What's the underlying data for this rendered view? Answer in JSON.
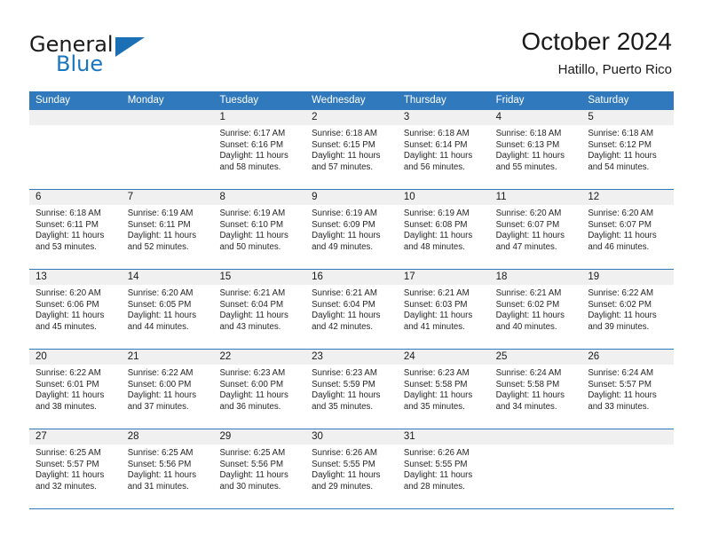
{
  "brand": {
    "name_part1": "General",
    "name_part2": "Blue",
    "flag_icon": "triangle-flag-icon"
  },
  "header": {
    "title": "October 2024",
    "location": "Hatillo, Puerto Rico"
  },
  "calendar": {
    "weekdays": [
      "Sunday",
      "Monday",
      "Tuesday",
      "Wednesday",
      "Thursday",
      "Friday",
      "Saturday"
    ],
    "accent_color": "#3079bd",
    "datestrip_color": "#f0f0f0",
    "weeks": [
      [
        {
          "day": "",
          "sunrise": "",
          "sunset": "",
          "daylight_l1": "",
          "daylight_l2": ""
        },
        {
          "day": "",
          "sunrise": "",
          "sunset": "",
          "daylight_l1": "",
          "daylight_l2": ""
        },
        {
          "day": "1",
          "sunrise": "Sunrise: 6:17 AM",
          "sunset": "Sunset: 6:16 PM",
          "daylight_l1": "Daylight: 11 hours",
          "daylight_l2": "and 58 minutes."
        },
        {
          "day": "2",
          "sunrise": "Sunrise: 6:18 AM",
          "sunset": "Sunset: 6:15 PM",
          "daylight_l1": "Daylight: 11 hours",
          "daylight_l2": "and 57 minutes."
        },
        {
          "day": "3",
          "sunrise": "Sunrise: 6:18 AM",
          "sunset": "Sunset: 6:14 PM",
          "daylight_l1": "Daylight: 11 hours",
          "daylight_l2": "and 56 minutes."
        },
        {
          "day": "4",
          "sunrise": "Sunrise: 6:18 AM",
          "sunset": "Sunset: 6:13 PM",
          "daylight_l1": "Daylight: 11 hours",
          "daylight_l2": "and 55 minutes."
        },
        {
          "day": "5",
          "sunrise": "Sunrise: 6:18 AM",
          "sunset": "Sunset: 6:12 PM",
          "daylight_l1": "Daylight: 11 hours",
          "daylight_l2": "and 54 minutes."
        }
      ],
      [
        {
          "day": "6",
          "sunrise": "Sunrise: 6:18 AM",
          "sunset": "Sunset: 6:11 PM",
          "daylight_l1": "Daylight: 11 hours",
          "daylight_l2": "and 53 minutes."
        },
        {
          "day": "7",
          "sunrise": "Sunrise: 6:19 AM",
          "sunset": "Sunset: 6:11 PM",
          "daylight_l1": "Daylight: 11 hours",
          "daylight_l2": "and 52 minutes."
        },
        {
          "day": "8",
          "sunrise": "Sunrise: 6:19 AM",
          "sunset": "Sunset: 6:10 PM",
          "daylight_l1": "Daylight: 11 hours",
          "daylight_l2": "and 50 minutes."
        },
        {
          "day": "9",
          "sunrise": "Sunrise: 6:19 AM",
          "sunset": "Sunset: 6:09 PM",
          "daylight_l1": "Daylight: 11 hours",
          "daylight_l2": "and 49 minutes."
        },
        {
          "day": "10",
          "sunrise": "Sunrise: 6:19 AM",
          "sunset": "Sunset: 6:08 PM",
          "daylight_l1": "Daylight: 11 hours",
          "daylight_l2": "and 48 minutes."
        },
        {
          "day": "11",
          "sunrise": "Sunrise: 6:20 AM",
          "sunset": "Sunset: 6:07 PM",
          "daylight_l1": "Daylight: 11 hours",
          "daylight_l2": "and 47 minutes."
        },
        {
          "day": "12",
          "sunrise": "Sunrise: 6:20 AM",
          "sunset": "Sunset: 6:07 PM",
          "daylight_l1": "Daylight: 11 hours",
          "daylight_l2": "and 46 minutes."
        }
      ],
      [
        {
          "day": "13",
          "sunrise": "Sunrise: 6:20 AM",
          "sunset": "Sunset: 6:06 PM",
          "daylight_l1": "Daylight: 11 hours",
          "daylight_l2": "and 45 minutes."
        },
        {
          "day": "14",
          "sunrise": "Sunrise: 6:20 AM",
          "sunset": "Sunset: 6:05 PM",
          "daylight_l1": "Daylight: 11 hours",
          "daylight_l2": "and 44 minutes."
        },
        {
          "day": "15",
          "sunrise": "Sunrise: 6:21 AM",
          "sunset": "Sunset: 6:04 PM",
          "daylight_l1": "Daylight: 11 hours",
          "daylight_l2": "and 43 minutes."
        },
        {
          "day": "16",
          "sunrise": "Sunrise: 6:21 AM",
          "sunset": "Sunset: 6:04 PM",
          "daylight_l1": "Daylight: 11 hours",
          "daylight_l2": "and 42 minutes."
        },
        {
          "day": "17",
          "sunrise": "Sunrise: 6:21 AM",
          "sunset": "Sunset: 6:03 PM",
          "daylight_l1": "Daylight: 11 hours",
          "daylight_l2": "and 41 minutes."
        },
        {
          "day": "18",
          "sunrise": "Sunrise: 6:21 AM",
          "sunset": "Sunset: 6:02 PM",
          "daylight_l1": "Daylight: 11 hours",
          "daylight_l2": "and 40 minutes."
        },
        {
          "day": "19",
          "sunrise": "Sunrise: 6:22 AM",
          "sunset": "Sunset: 6:02 PM",
          "daylight_l1": "Daylight: 11 hours",
          "daylight_l2": "and 39 minutes."
        }
      ],
      [
        {
          "day": "20",
          "sunrise": "Sunrise: 6:22 AM",
          "sunset": "Sunset: 6:01 PM",
          "daylight_l1": "Daylight: 11 hours",
          "daylight_l2": "and 38 minutes."
        },
        {
          "day": "21",
          "sunrise": "Sunrise: 6:22 AM",
          "sunset": "Sunset: 6:00 PM",
          "daylight_l1": "Daylight: 11 hours",
          "daylight_l2": "and 37 minutes."
        },
        {
          "day": "22",
          "sunrise": "Sunrise: 6:23 AM",
          "sunset": "Sunset: 6:00 PM",
          "daylight_l1": "Daylight: 11 hours",
          "daylight_l2": "and 36 minutes."
        },
        {
          "day": "23",
          "sunrise": "Sunrise: 6:23 AM",
          "sunset": "Sunset: 5:59 PM",
          "daylight_l1": "Daylight: 11 hours",
          "daylight_l2": "and 35 minutes."
        },
        {
          "day": "24",
          "sunrise": "Sunrise: 6:23 AM",
          "sunset": "Sunset: 5:58 PM",
          "daylight_l1": "Daylight: 11 hours",
          "daylight_l2": "and 35 minutes."
        },
        {
          "day": "25",
          "sunrise": "Sunrise: 6:24 AM",
          "sunset": "Sunset: 5:58 PM",
          "daylight_l1": "Daylight: 11 hours",
          "daylight_l2": "and 34 minutes."
        },
        {
          "day": "26",
          "sunrise": "Sunrise: 6:24 AM",
          "sunset": "Sunset: 5:57 PM",
          "daylight_l1": "Daylight: 11 hours",
          "daylight_l2": "and 33 minutes."
        }
      ],
      [
        {
          "day": "27",
          "sunrise": "Sunrise: 6:25 AM",
          "sunset": "Sunset: 5:57 PM",
          "daylight_l1": "Daylight: 11 hours",
          "daylight_l2": "and 32 minutes."
        },
        {
          "day": "28",
          "sunrise": "Sunrise: 6:25 AM",
          "sunset": "Sunset: 5:56 PM",
          "daylight_l1": "Daylight: 11 hours",
          "daylight_l2": "and 31 minutes."
        },
        {
          "day": "29",
          "sunrise": "Sunrise: 6:25 AM",
          "sunset": "Sunset: 5:56 PM",
          "daylight_l1": "Daylight: 11 hours",
          "daylight_l2": "and 30 minutes."
        },
        {
          "day": "30",
          "sunrise": "Sunrise: 6:26 AM",
          "sunset": "Sunset: 5:55 PM",
          "daylight_l1": "Daylight: 11 hours",
          "daylight_l2": "and 29 minutes."
        },
        {
          "day": "31",
          "sunrise": "Sunrise: 6:26 AM",
          "sunset": "Sunset: 5:55 PM",
          "daylight_l1": "Daylight: 11 hours",
          "daylight_l2": "and 28 minutes."
        },
        {
          "day": "",
          "sunrise": "",
          "sunset": "",
          "daylight_l1": "",
          "daylight_l2": ""
        },
        {
          "day": "",
          "sunrise": "",
          "sunset": "",
          "daylight_l1": "",
          "daylight_l2": ""
        }
      ]
    ]
  }
}
